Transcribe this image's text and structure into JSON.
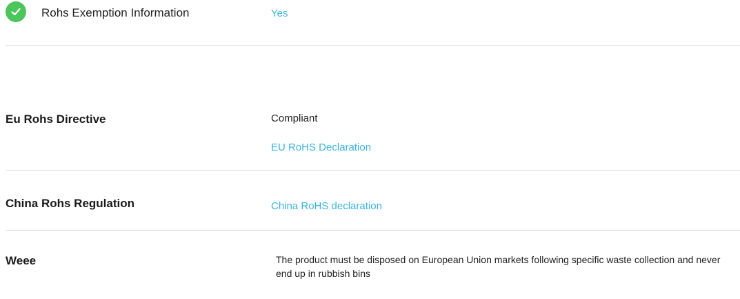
{
  "rohs_exemption": {
    "icon": "check-circle-icon",
    "icon_color": "#4cc55a",
    "label": "Rohs Exemption Information",
    "value": "Yes"
  },
  "eu_rohs": {
    "label": "Eu Rohs Directive",
    "status": "Compliant",
    "link": "EU RoHS Declaration"
  },
  "china_rohs": {
    "label": "China Rohs Regulation",
    "link": "China RoHS declaration"
  },
  "weee": {
    "label": "Weee",
    "text": "The product must be disposed on European Union markets following specific waste collection and never end up in rubbish bins"
  },
  "colors": {
    "link": "#3ab3e0",
    "divider": "#dddddd"
  }
}
